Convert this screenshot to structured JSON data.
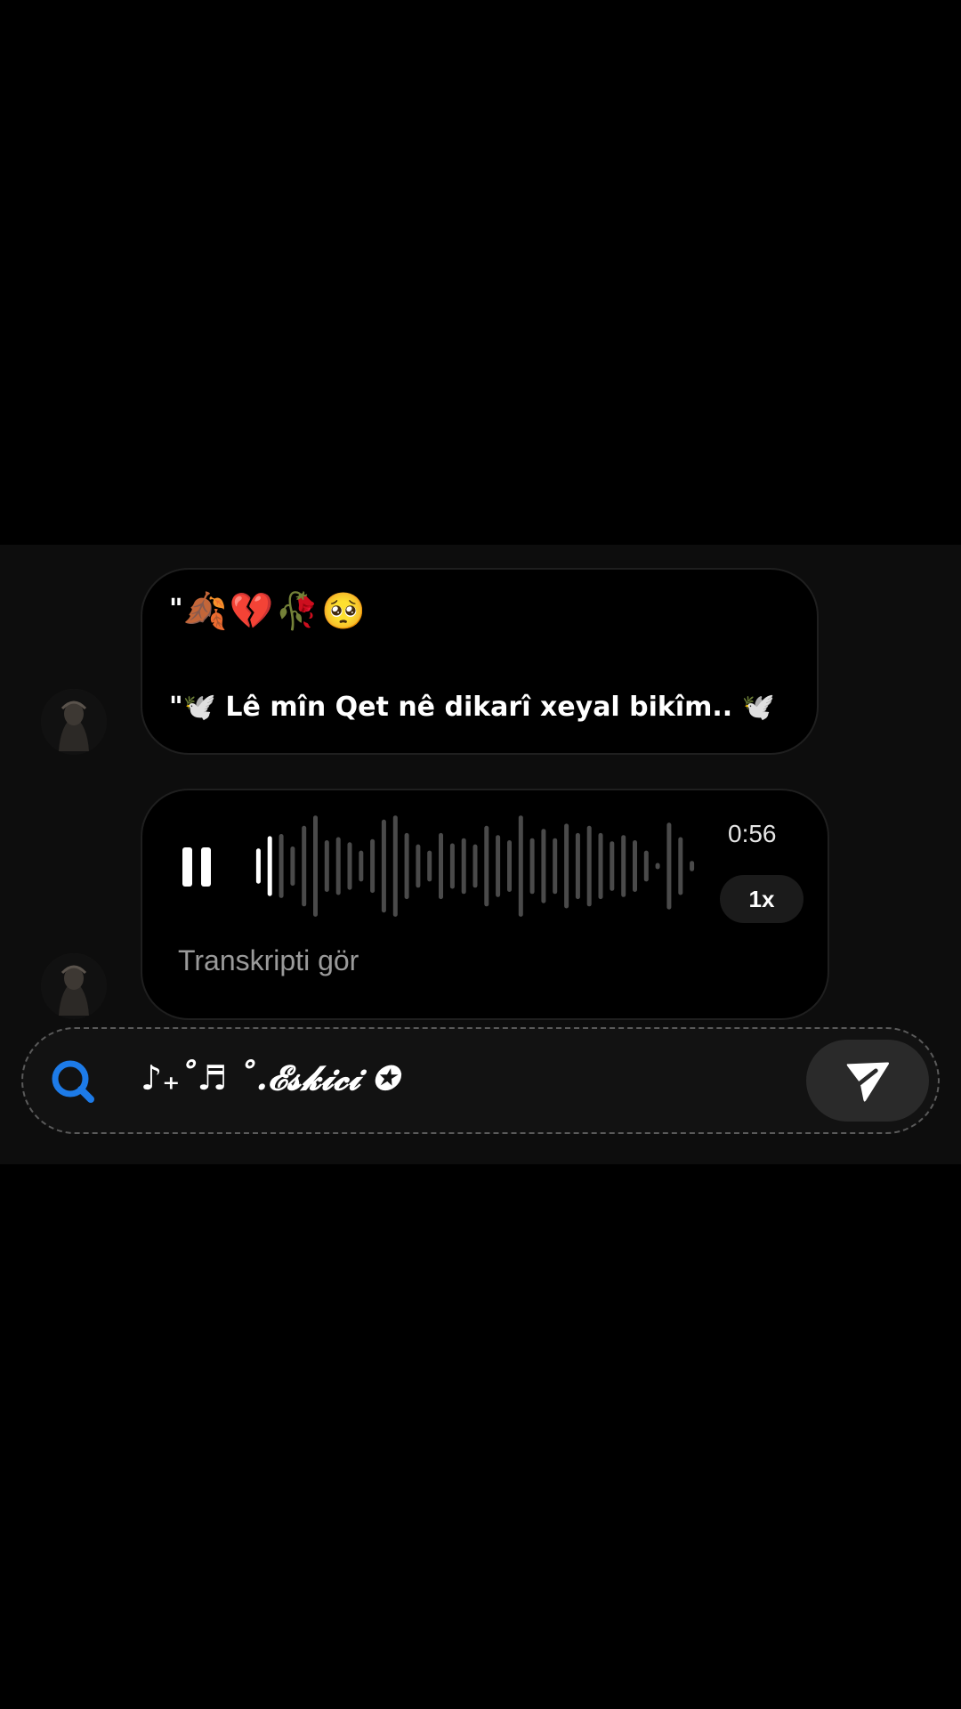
{
  "messages": [
    {
      "type": "text",
      "line1_prefix": "\"",
      "line1_emoji": "🍂💔🥀🥺",
      "line2": "\"🕊️ Lê mîn Qet nê dikarî xeyal bikîm.. 🕊️"
    },
    {
      "type": "voice",
      "state": "playing",
      "duration": "0:56",
      "speed": "1x",
      "transcript_label": "Transkripti gör",
      "played_fraction": 0.05,
      "waveform": [
        34,
        58,
        62,
        38,
        78,
        98,
        50,
        56,
        46,
        30,
        52,
        90,
        98,
        64,
        42,
        30,
        64,
        44,
        54,
        42,
        78,
        60,
        50,
        98,
        54,
        72,
        54,
        82,
        64,
        78,
        64,
        48,
        60,
        50,
        30,
        6,
        84,
        56,
        10
      ]
    }
  ],
  "composer": {
    "text": "♪₊˚♬ ˚.𝓔𝓼𝓴𝓲𝓬𝓲 ✪",
    "search_icon": "search-icon",
    "send_icon": "send-icon"
  },
  "colors": {
    "accent": "#1d7be8",
    "wave_played": "#ffffff",
    "wave_unplayed": "#4a4a4a"
  }
}
